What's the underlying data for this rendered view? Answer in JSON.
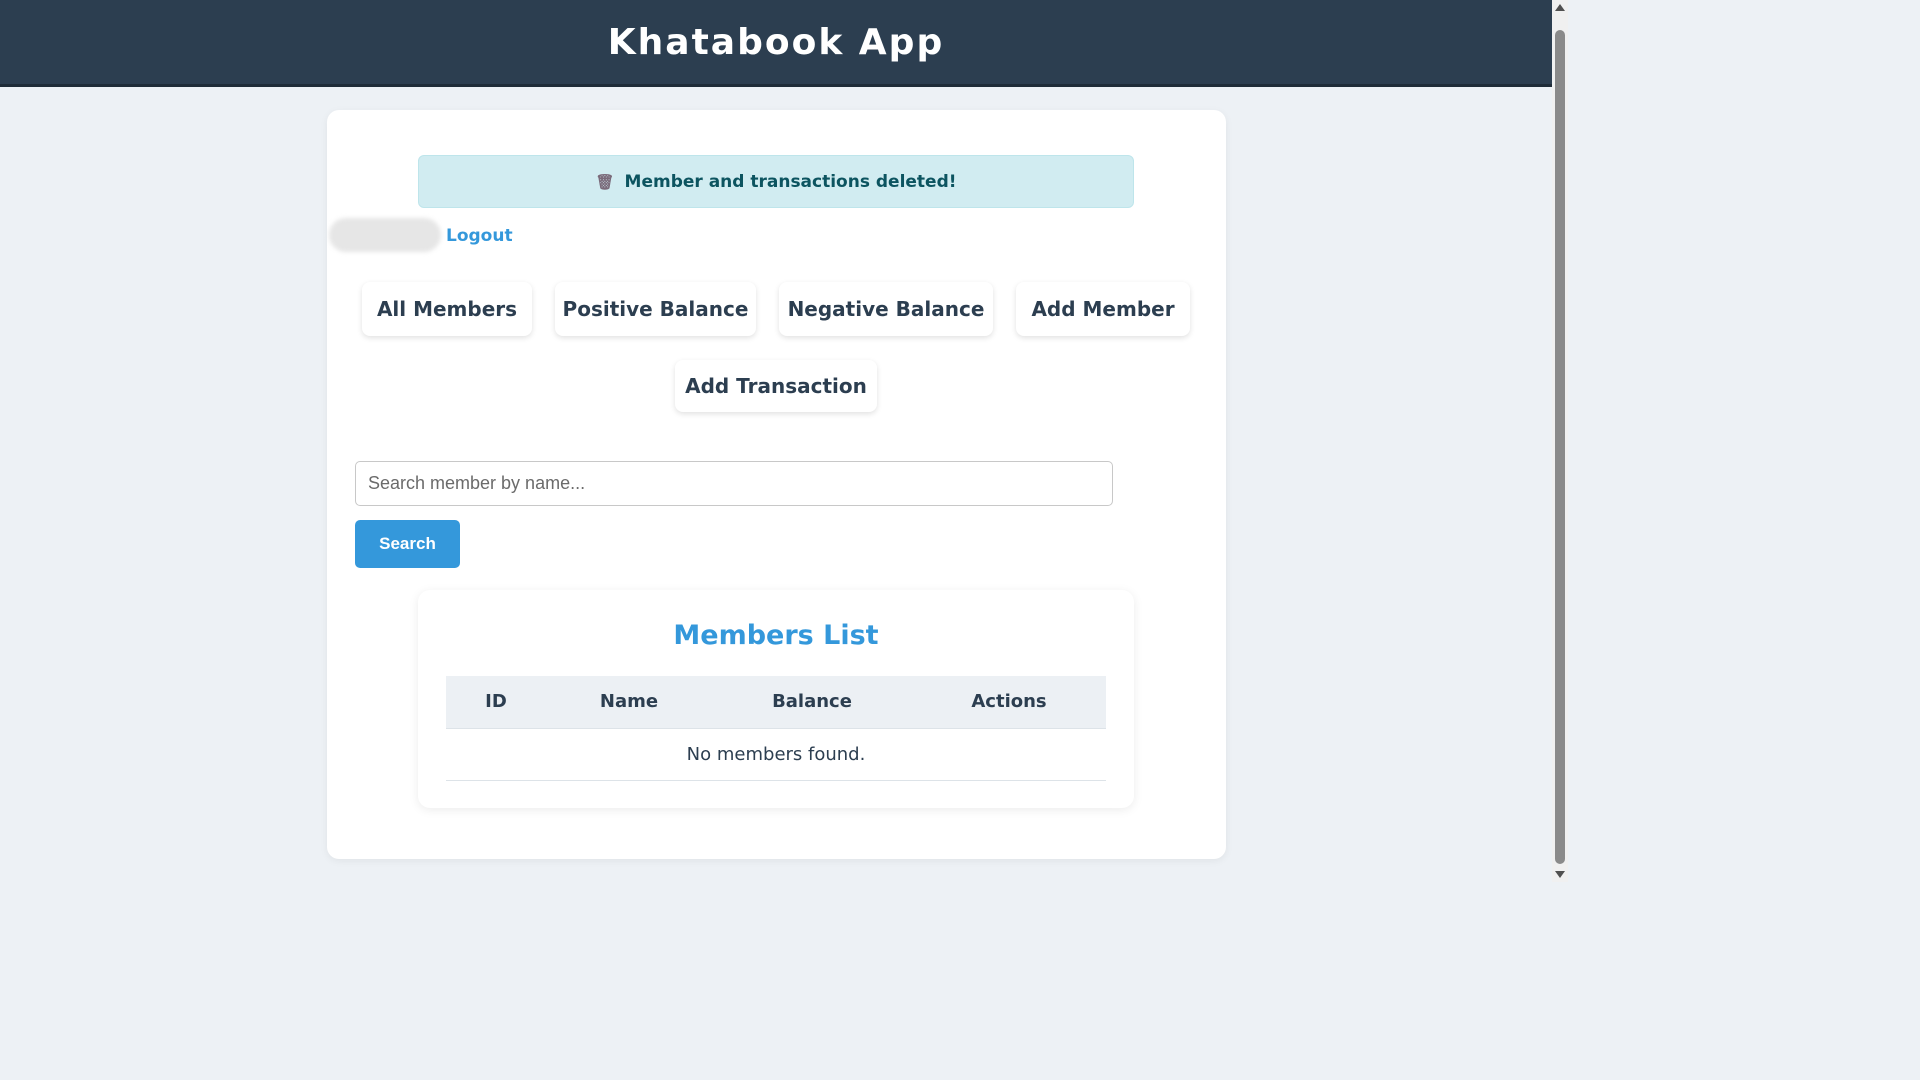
{
  "app": {
    "title": "Khatabook App"
  },
  "alert": {
    "icon": "trash-icon",
    "message": "Member and transactions deleted!"
  },
  "user": {
    "logout_label": "Logout"
  },
  "nav": {
    "all_members": "All Members",
    "positive_balance": "Positive Balance",
    "negative_balance": "Negative Balance",
    "add_member": "Add Member",
    "add_transaction": "Add Transaction"
  },
  "search": {
    "placeholder": "Search member by name...",
    "value": "",
    "button_label": "Search"
  },
  "members": {
    "title": "Members List",
    "columns": [
      "ID",
      "Name",
      "Balance",
      "Actions"
    ],
    "empty_message": "No members found."
  },
  "colors": {
    "header_bg": "#2c3e50",
    "accent": "#3498db",
    "alert_bg": "#d1ecf1",
    "alert_text": "#0c5460",
    "page_bg": "#edf1f5"
  }
}
